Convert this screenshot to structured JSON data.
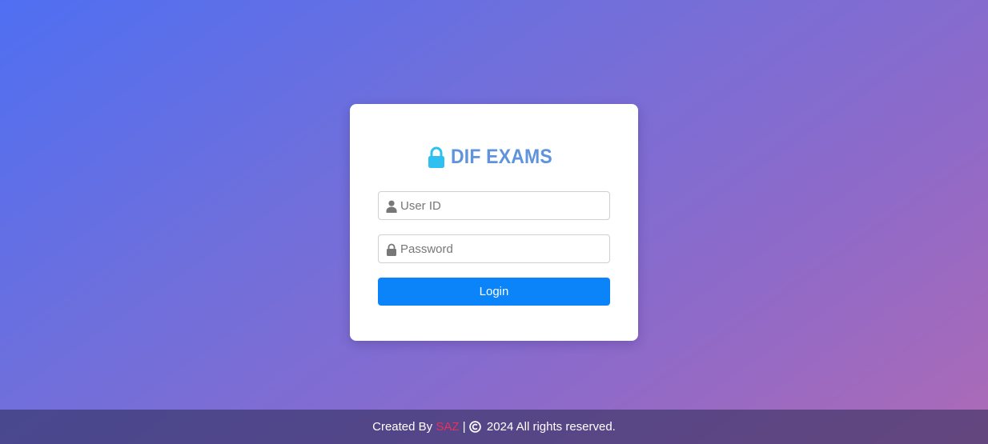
{
  "brand": {
    "title": "DIF EXAMS",
    "icon": "lock-icon",
    "title_color": "#5f93dc",
    "icon_color": "#2ec0f0"
  },
  "login_form": {
    "user_id": {
      "placeholder": "User ID",
      "value": "",
      "icon": "user-icon"
    },
    "password": {
      "placeholder": "Password",
      "value": "",
      "icon": "lock-icon"
    },
    "submit_label": "Login",
    "button_color": "#0a84f8"
  },
  "footer": {
    "prefix": "Created By ",
    "author": "SAZ",
    "separator": " | ",
    "copyright_icon": "copyright-icon",
    "text": " 2024 All rights reserved.",
    "author_color": "#e8305a"
  }
}
